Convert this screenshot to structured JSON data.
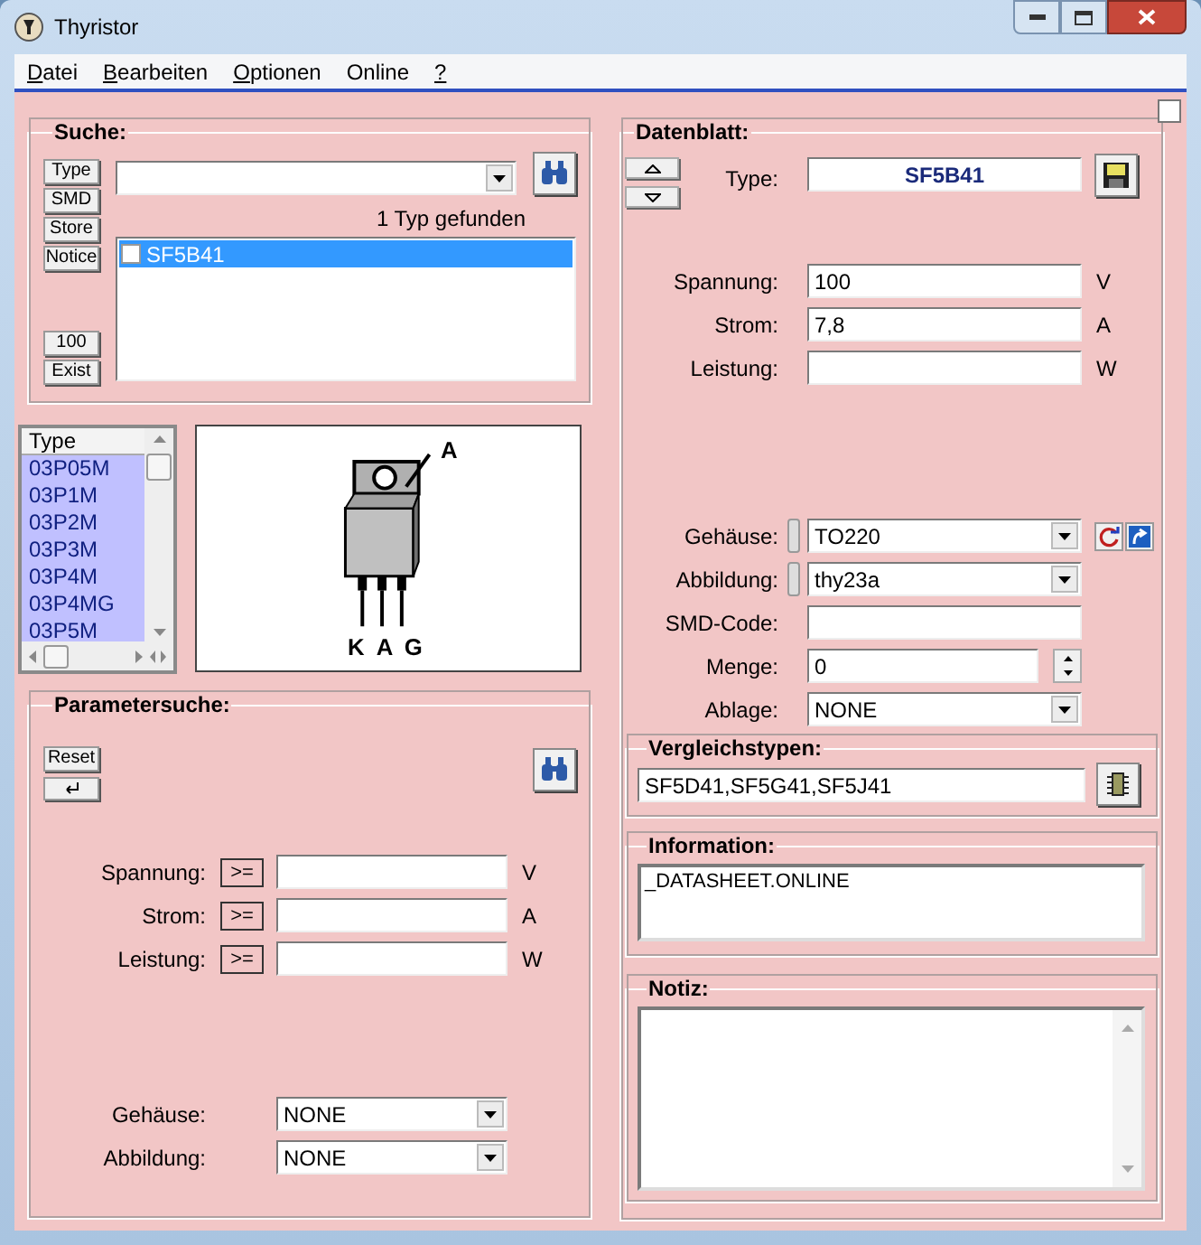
{
  "window": {
    "title": "Thyristor"
  },
  "menu": [
    {
      "label": "Datei",
      "mnemonic": true
    },
    {
      "label": "Bearbeiten",
      "mnemonic": true
    },
    {
      "label": "Optionen",
      "mnemonic": true
    },
    {
      "label": "Online",
      "mnemonic": false
    },
    {
      "label": "?",
      "mnemonic": true
    }
  ],
  "corner_checkbox": {
    "checked": false
  },
  "search": {
    "title": "Suche:",
    "side_buttons": [
      "Type",
      "SMD",
      "Store",
      "Notice"
    ],
    "bottom_buttons": [
      "100",
      "Exist"
    ],
    "result_count": "1 Typ gefunden",
    "results": [
      {
        "label": "SF5B41",
        "checked": false,
        "selected": true
      }
    ]
  },
  "type_list": {
    "header": "Type",
    "items": [
      "03P05M",
      "03P1M",
      "03P2M",
      "03P3M",
      "03P4M",
      "03P4MG",
      "03P5M"
    ]
  },
  "package_drawing": {
    "tab_label": "A",
    "pin_labels": [
      "K",
      "A",
      "G"
    ]
  },
  "parameter_search": {
    "title": "Parametersuche:",
    "reset": "Reset",
    "fields": [
      {
        "label": "Spannung:",
        "operator": ">=",
        "unit": "V"
      },
      {
        "label": "Strom:",
        "operator": ">=",
        "unit": "A"
      },
      {
        "label": "Leistung:",
        "operator": ">=",
        "unit": "W"
      }
    ],
    "selects": [
      {
        "label": "Gehäuse:",
        "value": "NONE"
      },
      {
        "label": "Abbildung:",
        "value": "NONE"
      }
    ]
  },
  "datasheet": {
    "title": "Datenblatt:",
    "type_label": "Type:",
    "type_value": "SF5B41",
    "fields": [
      {
        "label": "Spannung:",
        "value": "100",
        "unit": "V"
      },
      {
        "label": "Strom:",
        "value": "7,8",
        "unit": "A"
      },
      {
        "label": "Leistung:",
        "unit": "W"
      }
    ],
    "details": [
      {
        "kind": "select",
        "label": "Gehäuse:",
        "value": "TO220",
        "handle": true,
        "actions": true
      },
      {
        "kind": "select",
        "label": "Abbildung:",
        "value": "thy23a",
        "handle": true
      },
      {
        "kind": "text",
        "label": "SMD-Code:"
      },
      {
        "kind": "spin",
        "label": "Menge:",
        "value": "0"
      },
      {
        "kind": "select",
        "label": "Ablage:",
        "value": "NONE"
      }
    ]
  },
  "comparison": {
    "title": "Vergleichstypen:",
    "value": "SF5D41,SF5G41,SF5J41"
  },
  "information": {
    "title": "Information:",
    "value": "_DATASHEET.ONLINE"
  },
  "notes": {
    "title": "Notiz:"
  }
}
